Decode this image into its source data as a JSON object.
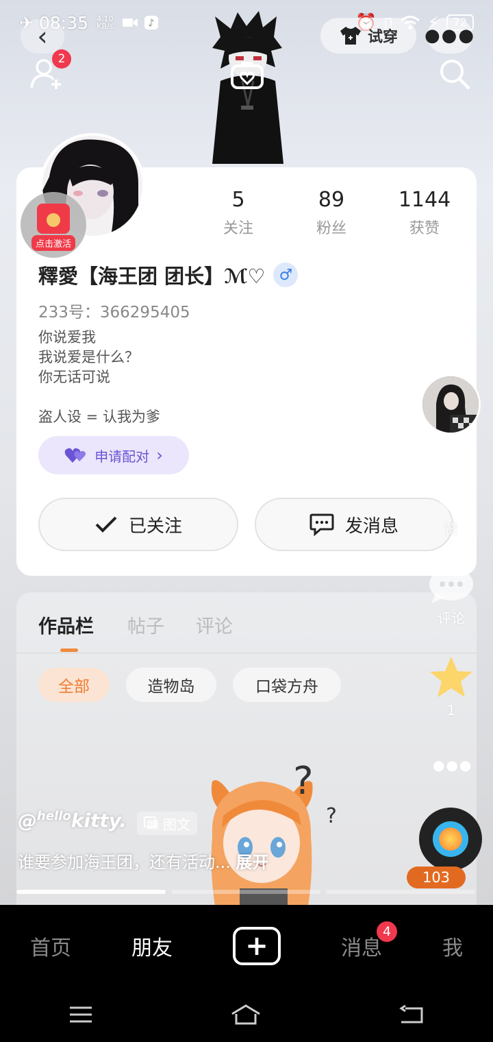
{
  "status_bar": {
    "time": "08:35",
    "speed_value": "4.10",
    "speed_unit": "KB/s",
    "battery": "72"
  },
  "header": {
    "tryon_label": "试穿",
    "friend_requests_badge": "2"
  },
  "profile": {
    "stats": [
      {
        "value": "5",
        "label": "关注"
      },
      {
        "value": "89",
        "label": "粉丝"
      },
      {
        "value": "1144",
        "label": "获赞"
      }
    ],
    "activate_label": "点击激活",
    "nickname": "釋愛【海王团 团长】ℳ♡",
    "gender_symbol": "♂",
    "uid": "233号：366295405",
    "bio": "你说爱我\n我说爱是什么？\n你无话可说\n\n盗人设 = 认我为爹",
    "pair_button": "申请配对",
    "followed_button": "已关注",
    "message_button": "发消息"
  },
  "side": {
    "like_label": "赞",
    "comment_label": "评论",
    "star_count": "1"
  },
  "tabs": [
    {
      "label": "作品栏",
      "active": true
    },
    {
      "label": "帖子",
      "active": false
    },
    {
      "label": "评论",
      "active": false
    }
  ],
  "filters": [
    {
      "label": "全部",
      "active": true
    },
    {
      "label": "造物岛",
      "active": false
    },
    {
      "label": "口袋方舟",
      "active": false
    }
  ],
  "post": {
    "author_prefix": "@",
    "author_hello": "hello",
    "author_kitty": "kitty",
    "author_dot": ".",
    "type_label": "图文",
    "caption": "谁要参加海王团，还有活动...",
    "expand": "展开",
    "count": "103"
  },
  "bottom_nav": {
    "home": "首页",
    "friends": "朋友",
    "messages": "消息",
    "messages_badge": "4",
    "me": "我"
  },
  "colors": {
    "accent_orange": "#ef7d33",
    "badge_red": "#f0384e",
    "pair_purple": "#6b54d4",
    "gender_blue": "#3b7de8"
  }
}
